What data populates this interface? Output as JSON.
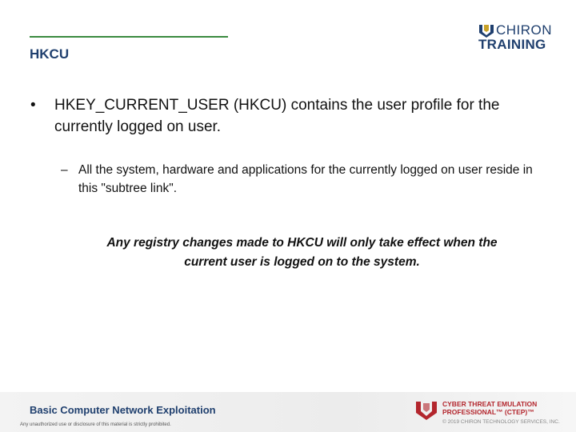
{
  "header": {
    "title": "HKCU",
    "logo": {
      "top": "CHIRON",
      "bottom": "TRAINING",
      "icon": "chiron-shield-icon"
    }
  },
  "content": {
    "bullet1": "HKEY_CURRENT_USER (HKCU) contains the user profile for the currently logged on user.",
    "bullet2": "All the system, hardware and applications for the currently logged on user reside in this \"subtree link\".",
    "emphasis_line1": "Any registry changes made to HKCU will only take effect when the",
    "emphasis_line2": "current user is logged on to the system."
  },
  "footer": {
    "course": "Basic Computer Network Exploitation",
    "legal": "Any unauthorized use or disclosure of this material is strictly prohibited.",
    "program_line1": "CYBER THREAT EMULATION",
    "program_line2": "PROFESSIONAL™ (CTEP)™",
    "copyright": "© 2019 CHIRON TECHNOLOGY SERVICES, INC."
  },
  "colors": {
    "navy": "#1f3f6e",
    "green": "#3a8a3f",
    "red": "#b3262d"
  }
}
